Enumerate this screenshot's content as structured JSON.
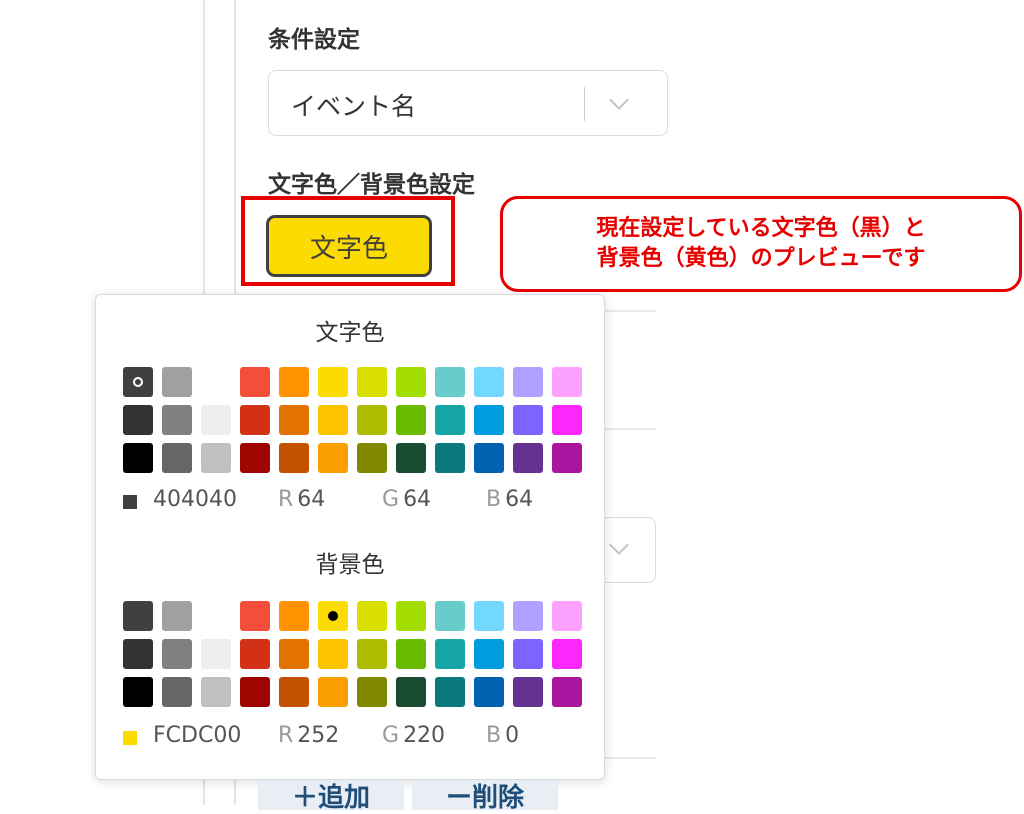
{
  "condition": {
    "heading": "条件設定",
    "select_value": "イベント名"
  },
  "color_setting": {
    "heading": "文字色／背景色設定",
    "preview_label": "文字色"
  },
  "callout": {
    "line1": "現在設定している文字色（黒）と",
    "line2": "背景色（黄色）のプレビューです"
  },
  "picker": {
    "text_section": {
      "title": "文字色",
      "hex": "404040",
      "r_label": "R",
      "r": "64",
      "g_label": "G",
      "g": "64",
      "b_label": "B",
      "b": "64",
      "color": "#404040"
    },
    "bg_section": {
      "title": "背景色",
      "hex": "FCDC00",
      "r_label": "R",
      "r": "252",
      "g_label": "G",
      "g": "220",
      "b_label": "B",
      "b": "0",
      "color": "#FCDC00"
    },
    "palette": [
      [
        "#404040",
        "#A0A0A0",
        "#FFFFFF",
        "#F44E3B",
        "#FE9200",
        "#FCDC00",
        "#DBDF00",
        "#A4DD00",
        "#68CCCA",
        "#73D8FF",
        "#AEA1FF",
        "#FDA1FF"
      ],
      [
        "#333333",
        "#808080",
        "#EEEEEE",
        "#D33115",
        "#E27300",
        "#FCC400",
        "#B0BC00",
        "#68BC00",
        "#16A5A5",
        "#009CE0",
        "#7B64FF",
        "#FA28FF"
      ],
      [
        "#000000",
        "#666666",
        "#C0C0C0",
        "#9F0500",
        "#C45100",
        "#FB9E00",
        "#808900",
        "#194D33",
        "#0C797D",
        "#0062B1",
        "#653294",
        "#AB149E"
      ]
    ]
  },
  "buttons": {
    "add": "＋追加",
    "remove": "ー削除"
  }
}
